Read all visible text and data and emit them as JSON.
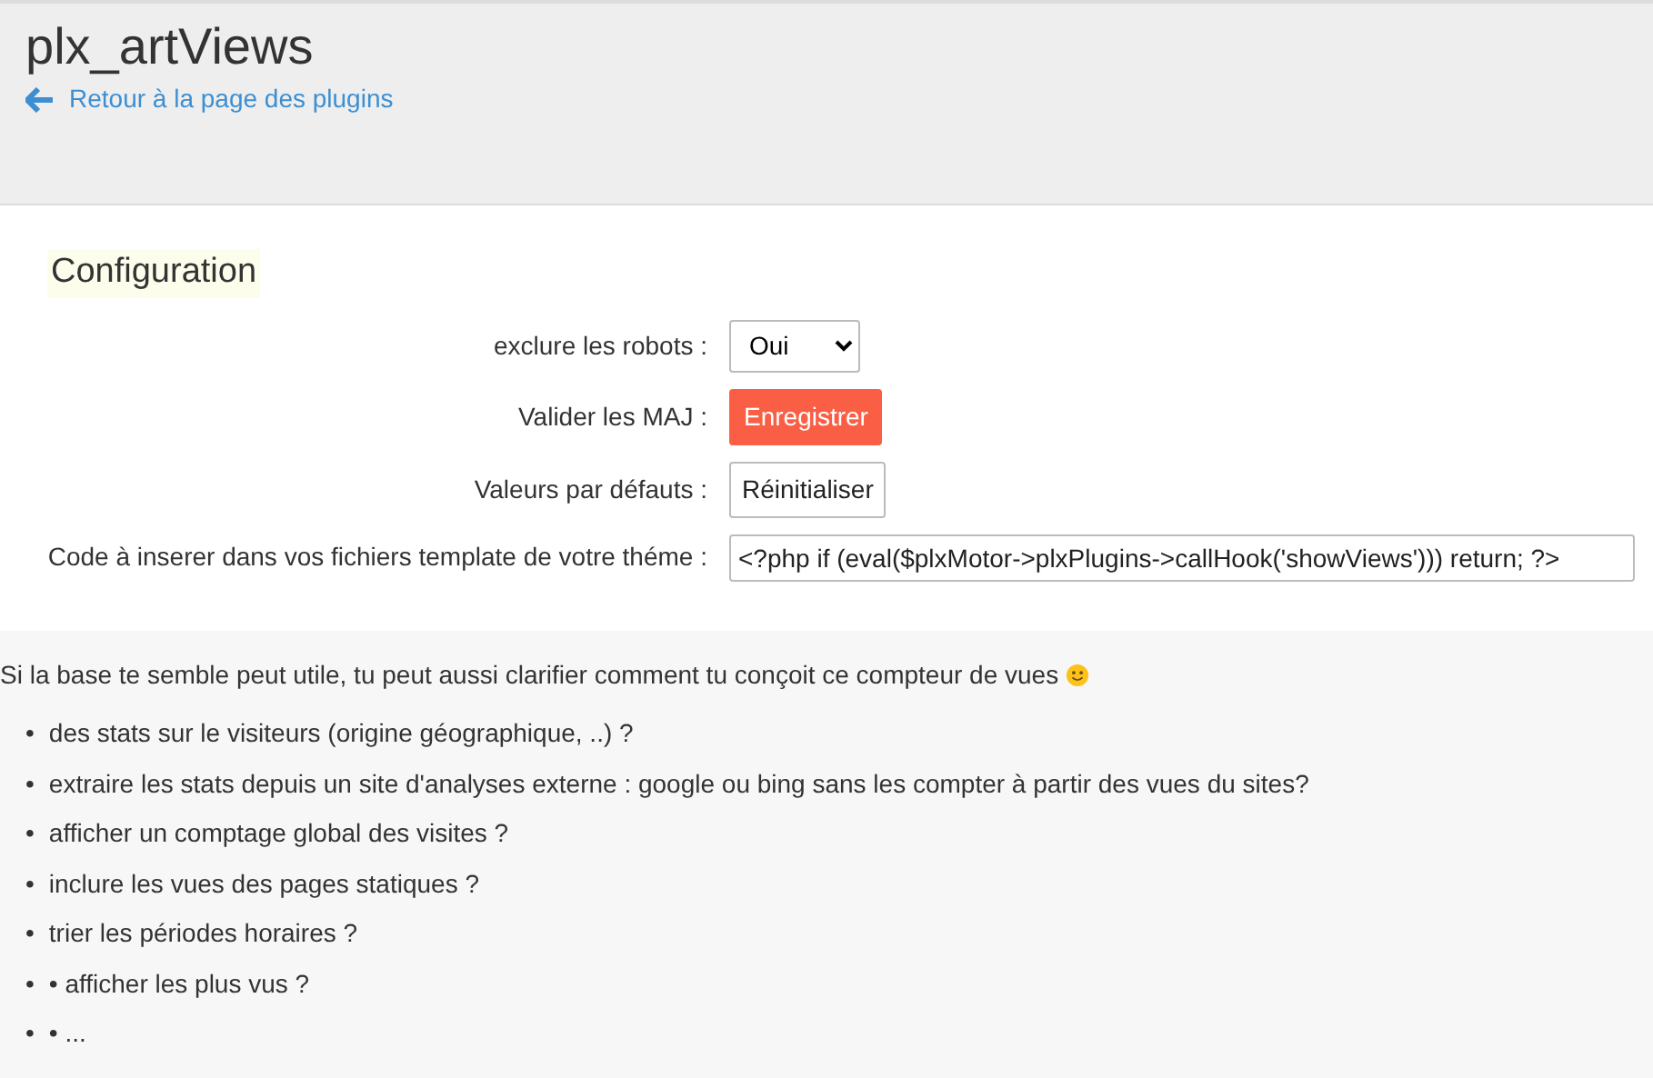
{
  "header": {
    "title": "plx_artViews",
    "back_link": "Retour à la page des plugins"
  },
  "config": {
    "heading": "Configuration",
    "rows": [
      {
        "kind": "select",
        "label": "exclure les robots :",
        "value": "Oui"
      },
      {
        "kind": "primary_button",
        "label": "Valider les MAJ :",
        "value": "Enregistrer"
      },
      {
        "kind": "button",
        "label": "Valeurs par défauts :",
        "value": "Réinitialiser"
      },
      {
        "kind": "text",
        "label": "Code à inserer dans vos fichiers template de votre théme :",
        "value": "<?php if (eval($plxMotor->plxPlugins->callHook('showViews'))) return; ?>"
      }
    ]
  },
  "comment": {
    "intro": "Si la base te semble peut utile, tu peut aussi clarifier comment tu conçoit ce compteur de vues",
    "items": [
      {
        "bullet": "•",
        "text": "des stats sur le visiteurs (origine géographique, ..) ?"
      },
      {
        "bullet": "•",
        "text": "extraire les stats depuis un site d'analyses externe : google ou bing sans les compter à partir des vues du sites?"
      },
      {
        "bullet": "•",
        "text": "afficher un comptage global des visites ?"
      },
      {
        "bullet": "•",
        "text": "inclure les vues des pages statiques ?"
      },
      {
        "bullet": "•",
        "text": "trier les périodes horaires ?"
      },
      {
        "bullet": "•",
        "text": "•  afficher les plus vus ?"
      },
      {
        "bullet": "•",
        "text": "•  ..."
      }
    ]
  }
}
